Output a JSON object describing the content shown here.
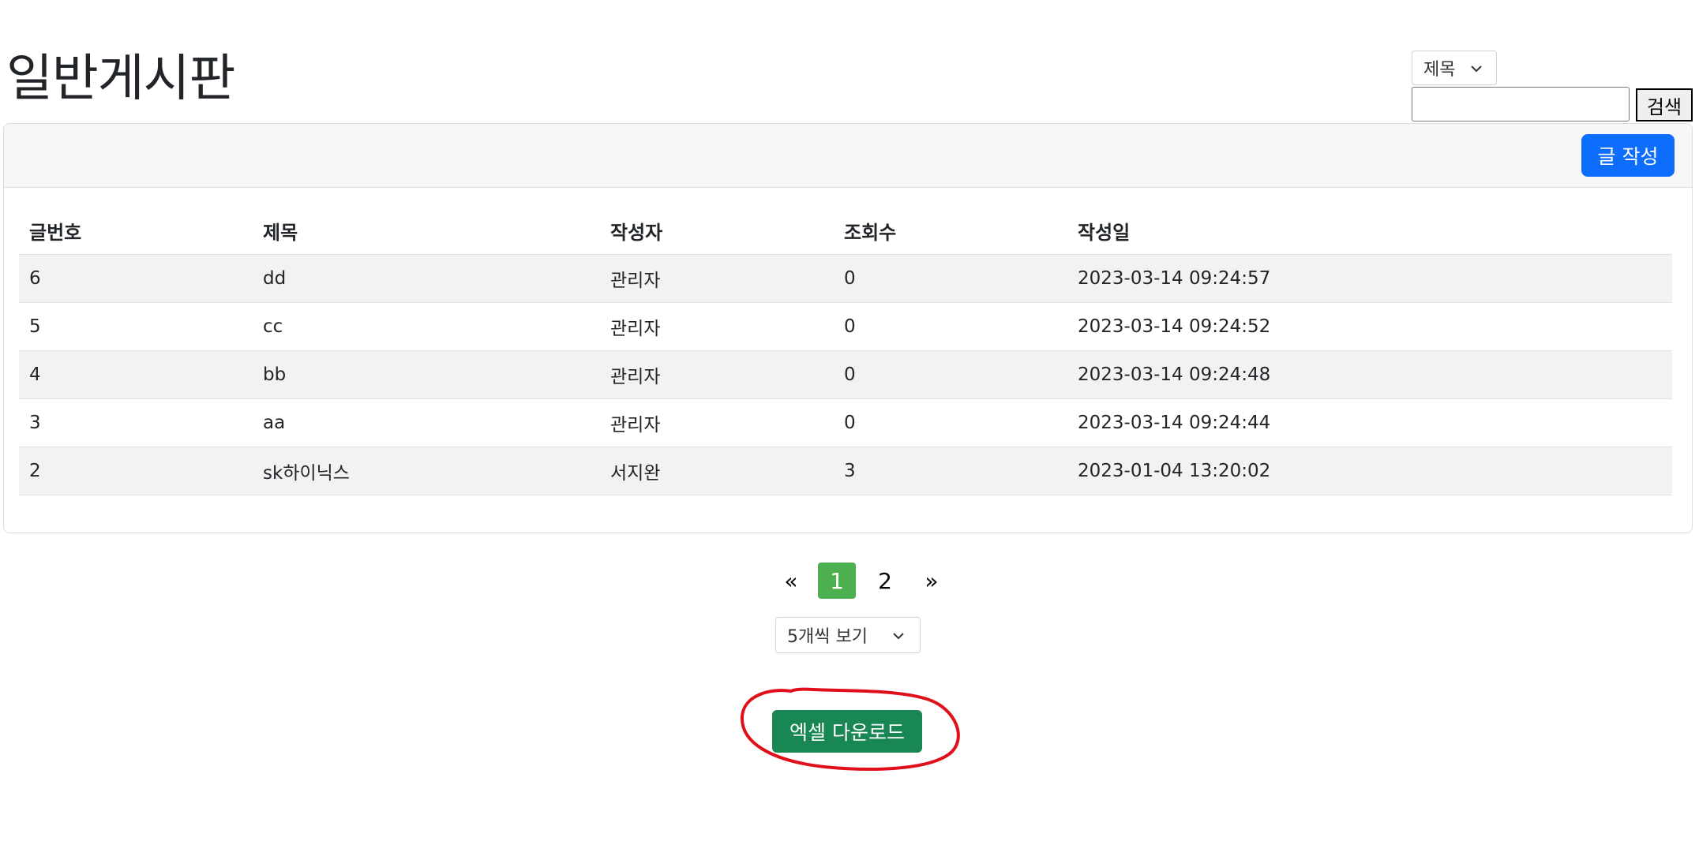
{
  "page": {
    "title": "일반게시판"
  },
  "search": {
    "field_selected": "제목",
    "input_value": "",
    "button_label": "검색"
  },
  "toolbar": {
    "write_label": "글 작성"
  },
  "table": {
    "columns": [
      "글번호",
      "제목",
      "작성자",
      "조회수",
      "작성일"
    ],
    "rows": [
      [
        "6",
        "dd",
        "관리자",
        "0",
        "2023-03-14 09:24:57"
      ],
      [
        "5",
        "cc",
        "관리자",
        "0",
        "2023-03-14 09:24:52"
      ],
      [
        "4",
        "bb",
        "관리자",
        "0",
        "2023-03-14 09:24:48"
      ],
      [
        "3",
        "aa",
        "관리자",
        "0",
        "2023-03-14 09:24:44"
      ],
      [
        "2",
        "sk하이닉스",
        "서지완",
        "3",
        "2023-01-04 13:20:02"
      ]
    ]
  },
  "pagination": {
    "prev": "«",
    "pages": [
      "1",
      "2"
    ],
    "current": "1",
    "next": "»"
  },
  "page_size": {
    "selected": "5개씩 보기"
  },
  "export": {
    "excel_label": "엑셀 다운로드"
  },
  "colors": {
    "primary": "#0d6efd",
    "success": "#198754",
    "active_page": "#4caf50",
    "annotation": "#e0101a"
  }
}
